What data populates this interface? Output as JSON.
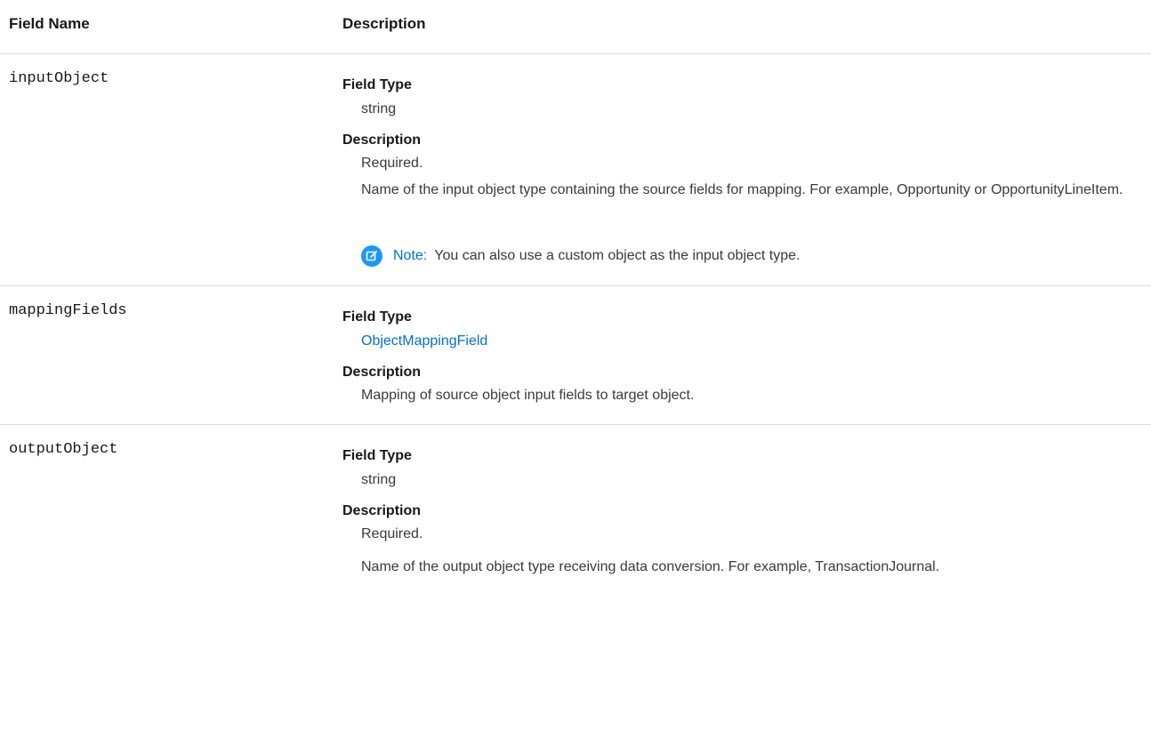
{
  "header": {
    "field_name": "Field Name",
    "description": "Description"
  },
  "rows": [
    {
      "name": "inputObject",
      "field_type_term": "Field Type",
      "field_type": "string",
      "description_term": "Description",
      "required": "Required.",
      "description": "Name of the input object type containing the source fields for mapping. For example, Opportunity or OpportunityLineItem.",
      "note_label": "Note:",
      "note_text": "You can also use a custom object as the input object type.",
      "note_icon": "edit-note-icon"
    },
    {
      "name": "mappingFields",
      "field_type_term": "Field Type",
      "field_type": "ObjectMappingField",
      "description_term": "Description",
      "description": "Mapping of source object input fields to target object."
    },
    {
      "name": "outputObject",
      "field_type_term": "Field Type",
      "field_type": "string",
      "description_term": "Description",
      "required": "Required.",
      "description": "Name of the output object type receiving data conversion. For example, TransactionJournal."
    }
  ],
  "colors": {
    "link": "#0070d2",
    "note_icon_bg": "#1b96ff",
    "divider": "#d9d9d9"
  }
}
